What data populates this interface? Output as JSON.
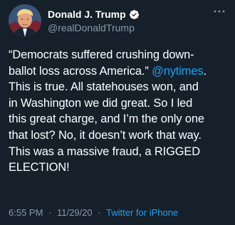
{
  "tweet": {
    "author": {
      "display_name": "Donald J. Trump",
      "handle": "@realDonaldTrump",
      "verified_icon": "verified-badge-icon"
    },
    "more_icon": "more-options-icon",
    "lines": [
      {
        "parts": [
          {
            "text": "“Democrats suffered crushing down-"
          }
        ]
      },
      {
        "parts": [
          {
            "text": "ballot loss across America.” "
          },
          {
            "text": "@nytimes",
            "mention": true
          },
          {
            "text": "."
          }
        ]
      },
      {
        "parts": [
          {
            "text": "This is true. All statehouses won, and"
          }
        ]
      },
      {
        "parts": [
          {
            "text": "in Washington we did great. So I led"
          }
        ]
      },
      {
        "parts": [
          {
            "text": "this great charge, and I’m the only one"
          }
        ]
      },
      {
        "parts": [
          {
            "text": "that lost? No, it doesn’t work that way."
          }
        ]
      },
      {
        "parts": [
          {
            "text": "This was a massive fraud, a RIGGED"
          }
        ]
      },
      {
        "parts": [
          {
            "text": "ELECTION!"
          }
        ]
      }
    ],
    "time": "6:55 PM",
    "date": "11/29/20",
    "separator": "·",
    "source": "Twitter for iPhone"
  },
  "colors": {
    "background": "#15202b",
    "text": "#ffffff",
    "secondary": "#8899a6",
    "accent": "#1da1f2"
  }
}
